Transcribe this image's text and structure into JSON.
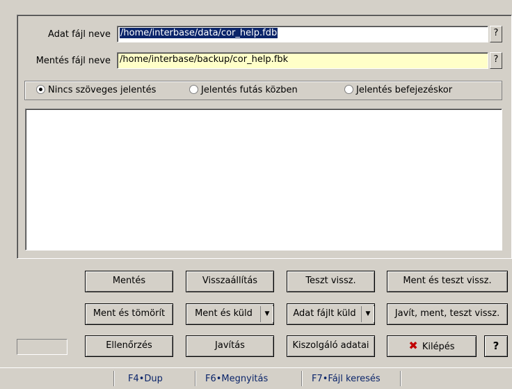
{
  "form": {
    "data_file_label": "Adat fájl neve",
    "data_file_value": "/home/interbase/data/cor_help.fdb",
    "backup_file_label": "Mentés fájl neve",
    "backup_file_value": "/home/interbase/backup/cor_help.fbk",
    "help_button": "?"
  },
  "report_options": {
    "selected": "Nincs szöveges jelentés",
    "options": [
      "Nincs szöveges jelentés",
      "Jelentés futás közben",
      "Jelentés befejezéskor"
    ]
  },
  "buttons": {
    "backup": "Mentés",
    "restore": "Visszaállítás",
    "test_restore": "Teszt vissz.",
    "backup_and_test": "Ment és teszt vissz.",
    "backup_compress": "Ment és tömörít",
    "backup_send": "Ment és küld",
    "send_data_file": "Adat fájlt küld",
    "fix_backup_test": "Javít, ment, teszt vissz.",
    "check": "Ellenőrzés",
    "fix": "Javítás",
    "server_info": "Kiszolgáló adatai",
    "exit": "Kilépés",
    "help": "?"
  },
  "statusbar": {
    "items": [
      "F4•Dup",
      "F6•Megnyitás",
      "F7•Fájl keresés"
    ]
  },
  "colors": {
    "window_bg": "#d4d0c8",
    "selection": "#0a246a",
    "yellow_field": "#ffffc8",
    "exit_icon": "#c00000"
  }
}
